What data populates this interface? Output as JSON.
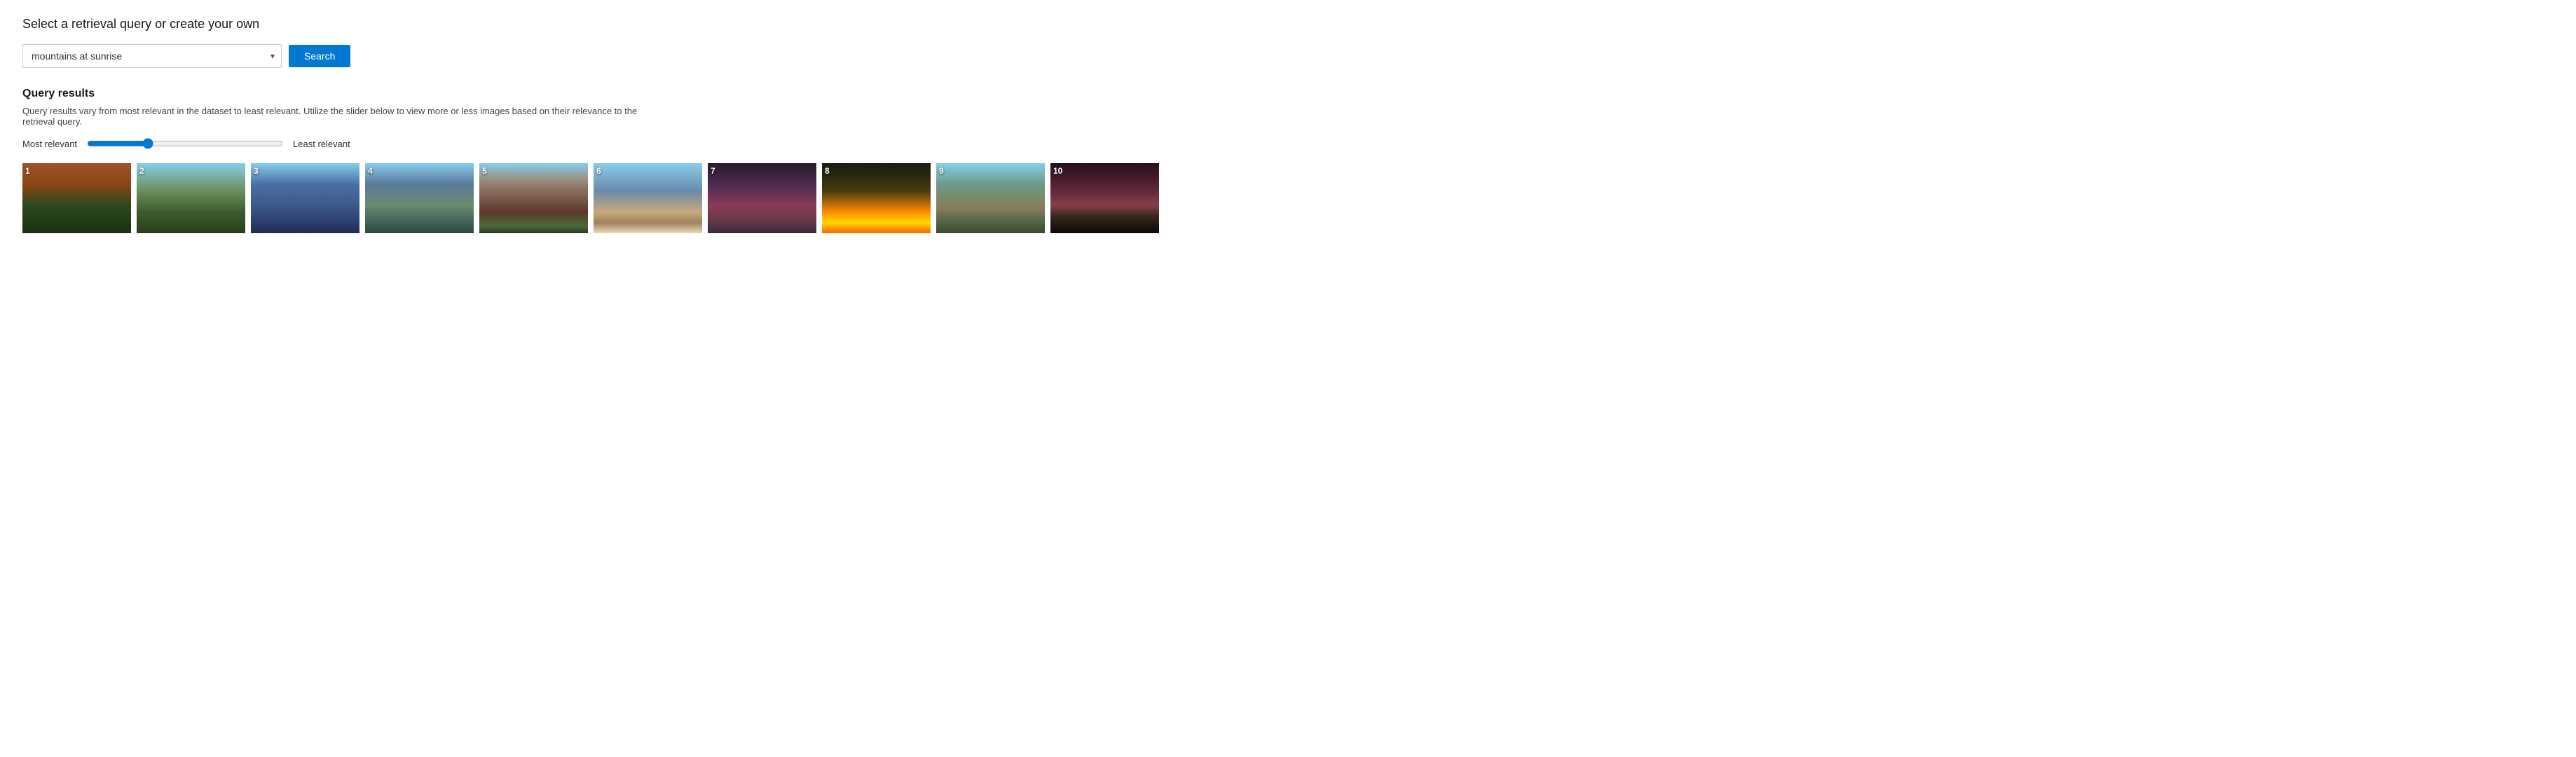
{
  "page": {
    "title": "Select a retrieval query or create your own"
  },
  "search": {
    "input_value": "mountains at sunrise",
    "input_placeholder": "mountains at sunrise",
    "button_label": "Search",
    "chevron": "▾"
  },
  "query_results": {
    "title": "Query results",
    "description": "Query results vary from most relevant in the dataset to least relevant. Utilize the slider below to view more or less images based on their relevance to the retrieval query.",
    "slider": {
      "min": 0,
      "max": 100,
      "value": 30,
      "label_left": "Most relevant",
      "label_right": "Least relevant"
    }
  },
  "images": [
    {
      "number": "1",
      "class": "img-1"
    },
    {
      "number": "2",
      "class": "img-2"
    },
    {
      "number": "3",
      "class": "img-3"
    },
    {
      "number": "4",
      "class": "img-4"
    },
    {
      "number": "5",
      "class": "img-5"
    },
    {
      "number": "6",
      "class": "img-6"
    },
    {
      "number": "7",
      "class": "img-7"
    },
    {
      "number": "8",
      "class": "img-8"
    },
    {
      "number": "9",
      "class": "img-9"
    },
    {
      "number": "10",
      "class": "img-10"
    }
  ],
  "colors": {
    "accent": "#0078d4"
  }
}
